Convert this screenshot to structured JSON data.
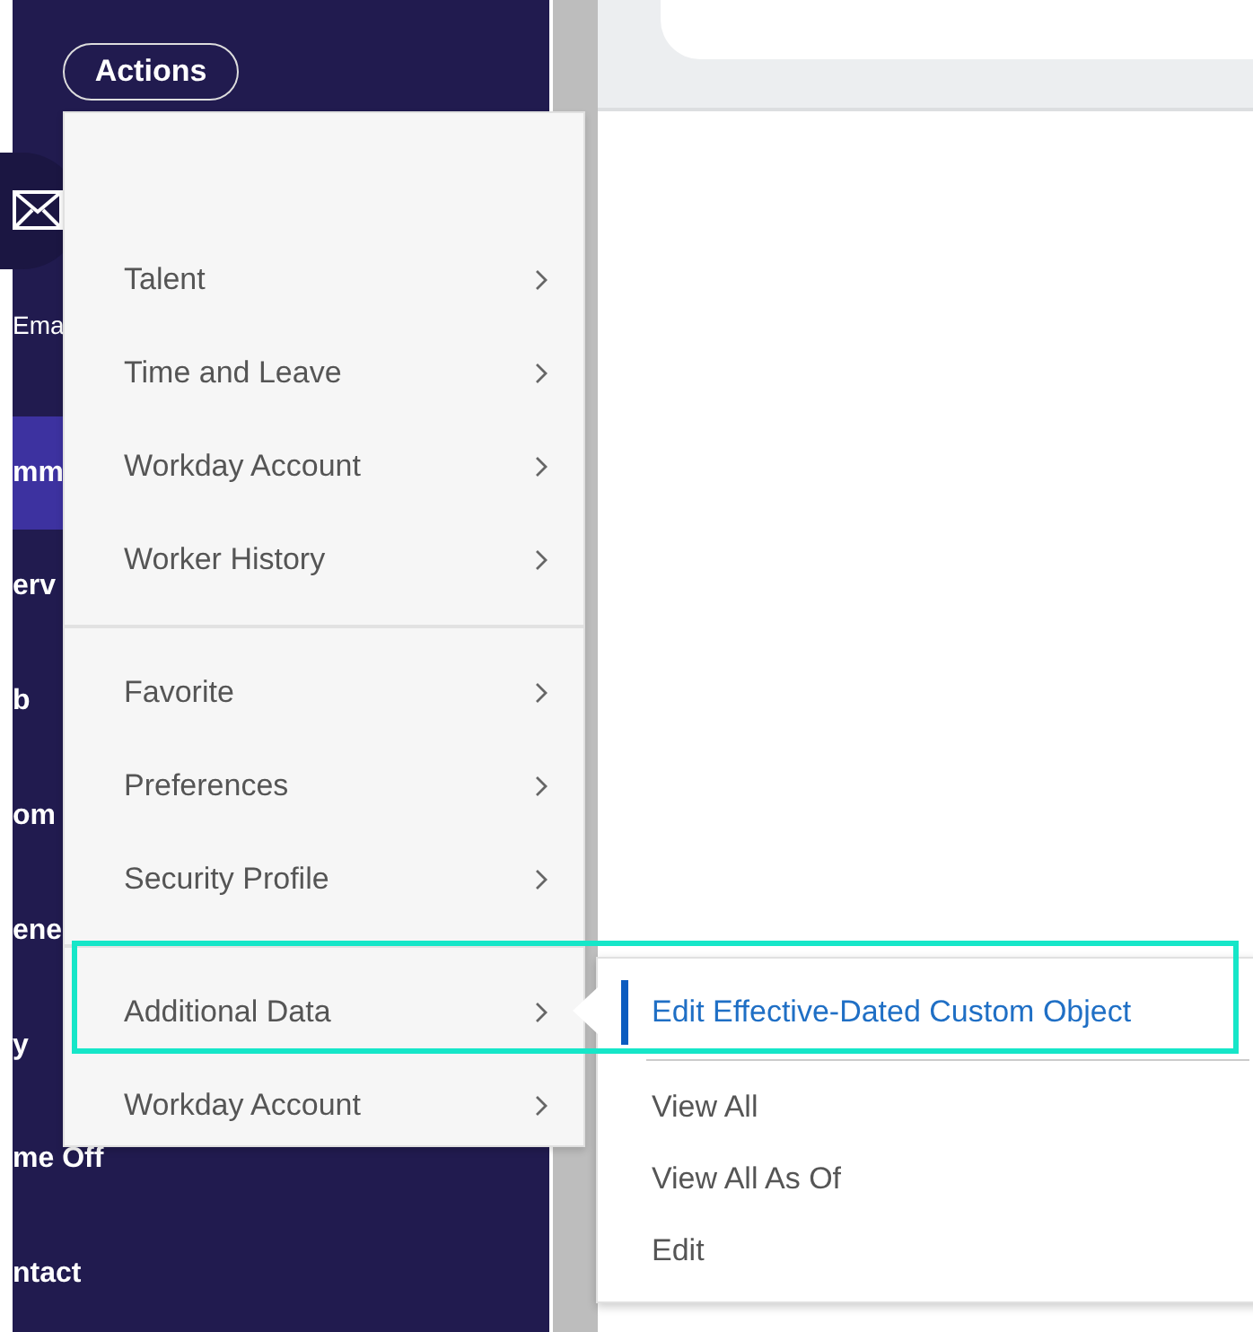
{
  "actions_button": {
    "label": "Actions"
  },
  "sidebar": {
    "email_label": "Ema",
    "items": [
      {
        "label": "mm",
        "selected": true
      },
      {
        "label": "erv",
        "selected": false
      },
      {
        "label": "b",
        "selected": false
      },
      {
        "label": "om",
        "selected": false
      },
      {
        "label": "ene",
        "selected": false
      },
      {
        "label": "y",
        "selected": false
      },
      {
        "label": "me Off",
        "selected": false
      },
      {
        "label": "ntact",
        "selected": false
      }
    ]
  },
  "menu": {
    "groups": [
      [
        {
          "label": "Talent"
        },
        {
          "label": "Time and Leave"
        },
        {
          "label": "Workday Account"
        },
        {
          "label": "Worker History"
        }
      ],
      [
        {
          "label": "Favorite"
        },
        {
          "label": "Preferences"
        },
        {
          "label": "Security Profile"
        }
      ],
      [
        {
          "label": "Additional Data"
        },
        {
          "label": "Workday Account"
        }
      ]
    ]
  },
  "submenu": {
    "groups": [
      [
        {
          "label": "Edit Effective-Dated Custom Object",
          "selected": true
        }
      ],
      [
        {
          "label": "View All",
          "selected": false
        },
        {
          "label": "View All As Of",
          "selected": false
        },
        {
          "label": "Edit",
          "selected": false
        }
      ]
    ]
  }
}
